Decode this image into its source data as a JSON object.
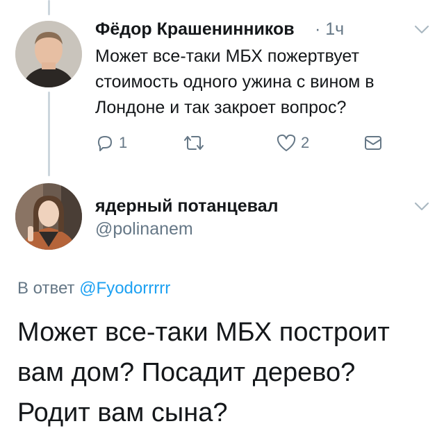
{
  "tweet1": {
    "name": "Фёдор Крашенинников",
    "separator": "·",
    "time": "1ч",
    "text": "Может все-таки МБХ пожертвует стоимость одного ужина с вином в Лондоне и так закроет вопрос?",
    "actions": {
      "reply_count": "1",
      "retweet_count": "",
      "like_count": "2"
    }
  },
  "tweet2": {
    "name": "ядерный потанцевал",
    "handle": "@polinanem",
    "reply_prefix": "В ответ",
    "reply_mention": "@Fyodorrrrr",
    "text": "Может все-таки МБХ построит вам дом? Посадит дерево? Родит вам сына?"
  },
  "colors": {
    "text": "#14171a",
    "secondary": "#657786",
    "link": "#1da1f2",
    "thread_line": "#ccd6dd"
  },
  "icons": [
    "chevron-down-icon",
    "reply-icon",
    "retweet-icon",
    "like-icon",
    "direct-message-icon"
  ]
}
